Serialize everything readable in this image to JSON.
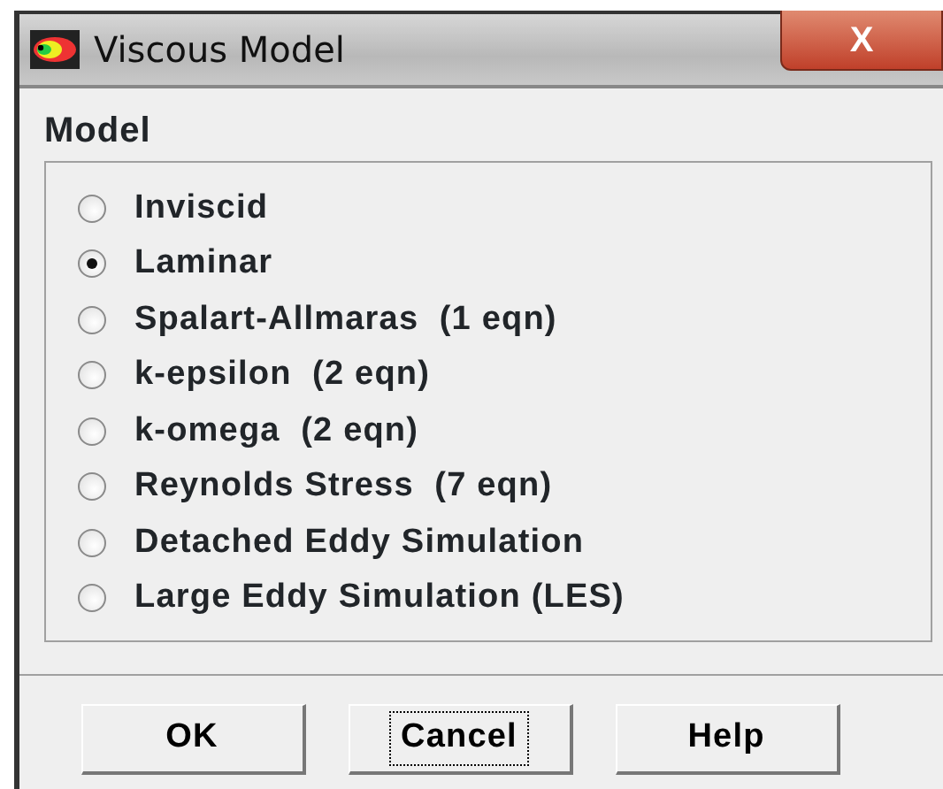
{
  "window": {
    "title": "Viscous Model",
    "close": "X"
  },
  "model": {
    "label": "Model",
    "options": [
      {
        "label": "Inviscid",
        "selected": false
      },
      {
        "label": "Laminar",
        "selected": true
      },
      {
        "label": "Spalart-Allmaras  (1 eqn)",
        "selected": false
      },
      {
        "label": "k-epsilon  (2 eqn)",
        "selected": false
      },
      {
        "label": "k-omega  (2 eqn)",
        "selected": false
      },
      {
        "label": "Reynolds Stress  (7 eqn)",
        "selected": false
      },
      {
        "label": "Detached Eddy Simulation",
        "selected": false
      },
      {
        "label": "Large Eddy Simulation (LES)",
        "selected": false
      }
    ]
  },
  "buttons": [
    {
      "label": "OK",
      "focused": false
    },
    {
      "label": "Cancel",
      "focused": true
    },
    {
      "label": "Help",
      "focused": false
    }
  ]
}
